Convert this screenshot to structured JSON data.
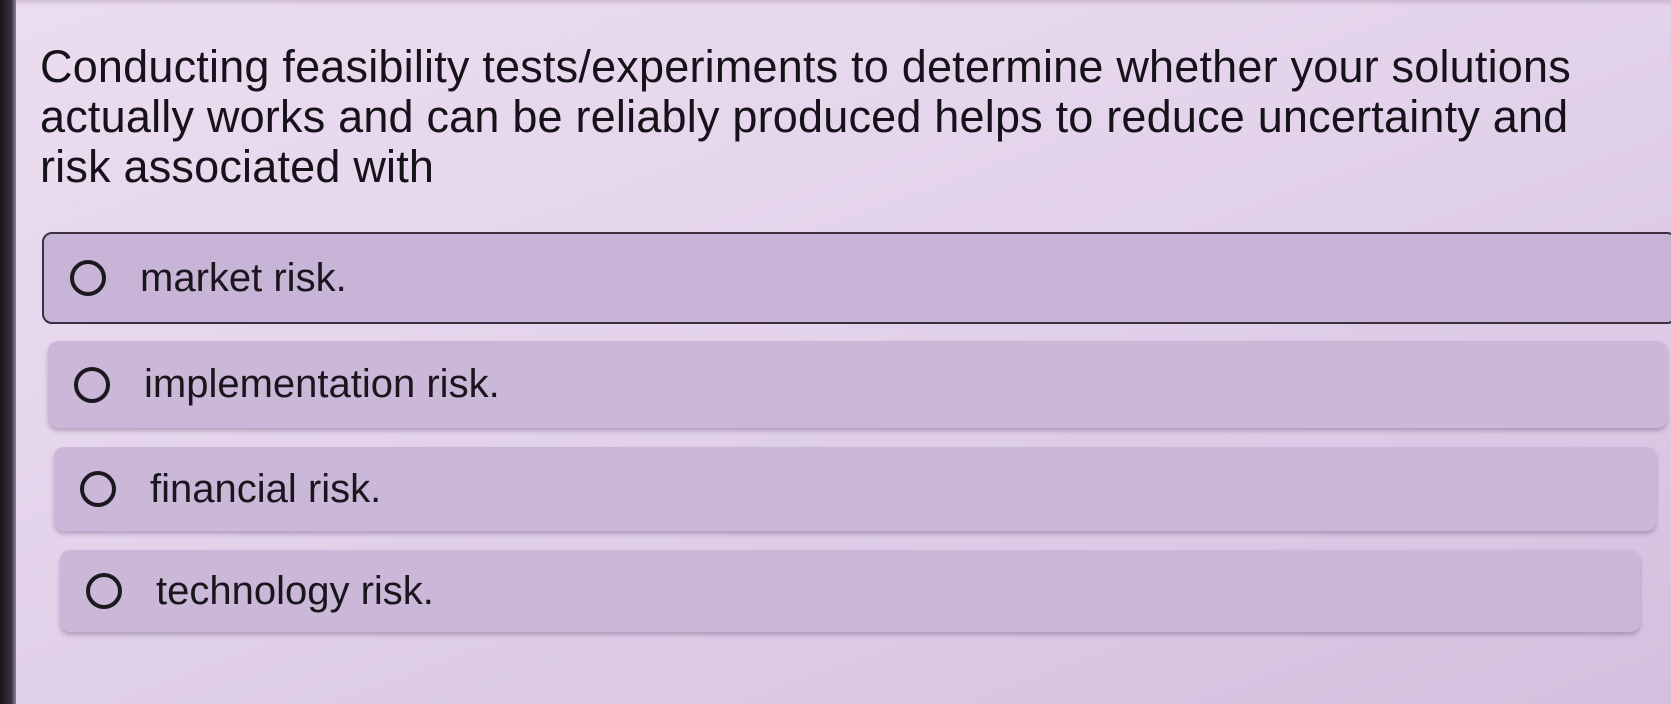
{
  "question": {
    "text": "Conducting feasibility tests/experiments to determine whether your solutions actually works and can be reliably produced helps to reduce uncertainty and risk associated with"
  },
  "options": [
    {
      "label": "market risk.",
      "selected": true
    },
    {
      "label": "implementation risk.",
      "selected": false
    },
    {
      "label": "financial risk.",
      "selected": false
    },
    {
      "label": "technology risk.",
      "selected": false
    }
  ],
  "icons": {
    "radio": "radio-circle-icon"
  },
  "colors": {
    "background": "#e6d6ec",
    "option_fill": "#cbb7d8",
    "text": "#161219"
  }
}
